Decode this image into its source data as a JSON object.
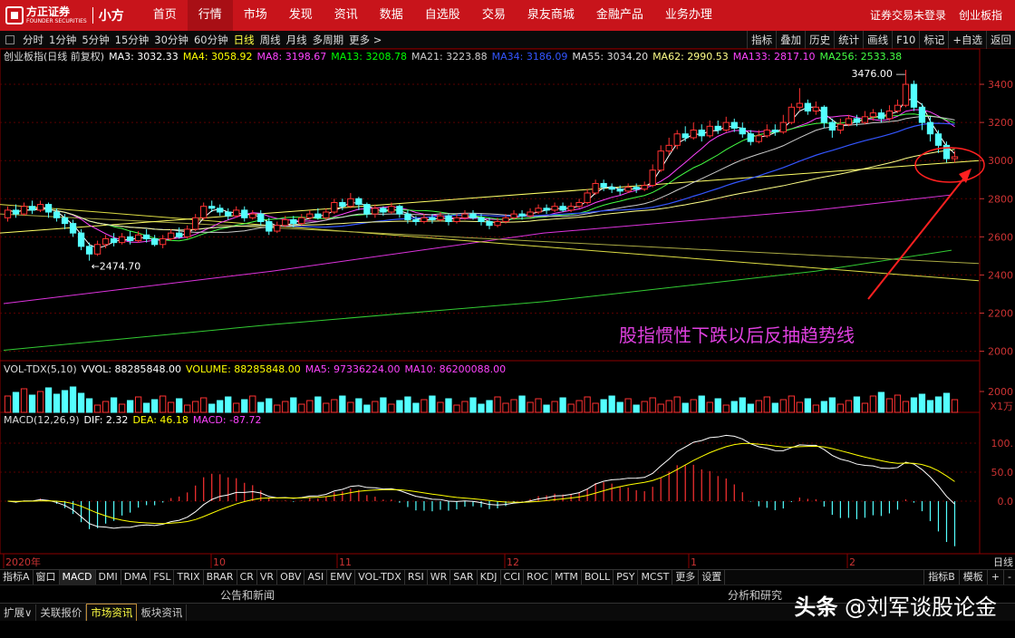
{
  "app": {
    "logo_cn": "方正证券",
    "logo_en": "FOUNDER SECURITIES",
    "logo_app": "小方"
  },
  "nav": [
    "首页",
    "行情",
    "市场",
    "发现",
    "资讯",
    "数据",
    "自选股",
    "交易",
    "泉友商城",
    "金融产品",
    "业务办理"
  ],
  "nav_active": 1,
  "nav_right": {
    "login": "证券交易未登录",
    "symbol": "创业板指"
  },
  "periods": [
    "分时",
    "1分钟",
    "5分钟",
    "15分钟",
    "30分钟",
    "60分钟",
    "日线",
    "周线",
    "月线",
    "多周期",
    "更多 >"
  ],
  "period_active": 6,
  "toolbar_right": [
    "指标",
    "叠加",
    "历史",
    "统计",
    "画线",
    "F10",
    "标记",
    "+自选",
    "返回"
  ],
  "ma_line": {
    "title": "创业板指(日线 前复权)",
    "items": [
      {
        "label": "MA3: 3032.33",
        "color": "#ffffff"
      },
      {
        "label": "MA4: 3058.92",
        "color": "#ffff00"
      },
      {
        "label": "MA8: 3198.67",
        "color": "#ff44ff"
      },
      {
        "label": "MA13: 3208.78",
        "color": "#00ff00"
      },
      {
        "label": "MA21: 3223.88",
        "color": "#cccccc"
      },
      {
        "label": "MA34: 3186.09",
        "color": "#3355ff"
      },
      {
        "label": "MA55: 3034.20",
        "color": "#dddddd"
      },
      {
        "label": "MA62: 2990.53",
        "color": "#ffff88"
      },
      {
        "label": "MA133: 2817.10",
        "color": "#ff44ff"
      },
      {
        "label": "MA256: 2533.38",
        "color": "#44ff44"
      }
    ]
  },
  "main_axis": [
    "3400",
    "3200",
    "3000",
    "2800",
    "2600",
    "2400",
    "2200",
    "2000"
  ],
  "main_annotations": {
    "high": "3476.00",
    "low": "2474.70"
  },
  "annotation_text": "股指惯性下跌以后反抽趋势线",
  "vol_line": {
    "items": [
      {
        "label": "VOL-TDX(5,10)",
        "color": "#dddddd"
      },
      {
        "label": "VVOL: 88285848.00",
        "color": "#ffffff"
      },
      {
        "label": "VOLUME: 88285848.00",
        "color": "#ffff00"
      },
      {
        "label": "MA5: 97336224.00",
        "color": "#ff44ff"
      },
      {
        "label": "MA10: 86200088.00",
        "color": "#ff44ff"
      }
    ]
  },
  "vol_axis": {
    "top": "2000",
    "unit": "X1万"
  },
  "macd_line": {
    "items": [
      {
        "label": "MACD(12,26,9)",
        "color": "#dddddd"
      },
      {
        "label": "DIF: 2.32",
        "color": "#ffffff"
      },
      {
        "label": "DEA: 46.18",
        "color": "#ffff00"
      },
      {
        "label": "MACD: -87.72",
        "color": "#ff44ff"
      }
    ]
  },
  "macd_axis": [
    "100.",
    "50.0",
    "0.0"
  ],
  "x_axis": {
    "labels": [
      {
        "text": "2020年",
        "pos": "start"
      },
      {
        "text": "10",
        "pos": "oct"
      },
      {
        "text": "11",
        "pos": "nov"
      },
      {
        "text": "12",
        "pos": "dec"
      },
      {
        "text": "1",
        "pos": "jan"
      },
      {
        "text": "2",
        "pos": "feb"
      }
    ],
    "right_label": "日线"
  },
  "indicator_tabs": [
    "指标A",
    "窗口",
    "MACD",
    "DMI",
    "DMA",
    "FSL",
    "TRIX",
    "BRAR",
    "CR",
    "VR",
    "OBV",
    "ASI",
    "EMV",
    "VOL-TDX",
    "RSI",
    "WR",
    "SAR",
    "KDJ",
    "CCI",
    "ROC",
    "MTM",
    "BOLL",
    "PSY",
    "MCST",
    "更多",
    "设置"
  ],
  "indicator_active": 2,
  "indicator_right": [
    "指标B",
    "模板",
    "+",
    "-"
  ],
  "news": {
    "left": "公告和新闻",
    "right": "分析和研究"
  },
  "bottom_tabs": [
    "扩展∨",
    "关联报价",
    "市场资讯",
    "板块资讯"
  ],
  "bottom_active": 2,
  "watermark": {
    "brand": "头条",
    "text": "@刘军谈股论金"
  },
  "colors": {
    "up": "#ff3232",
    "down": "#54ffff",
    "nav_bg": "#c8141b",
    "axis_red": "#cc3333"
  },
  "chart_data": {
    "type": "candlestick",
    "title": "创业板指(日线 前复权)",
    "y_ticks": [
      3400,
      3200,
      3000,
      2800,
      2600,
      2400,
      2200,
      2000
    ],
    "ylim": [
      1960,
      3500
    ],
    "candles": [
      [
        2700,
        2740,
        2760,
        2680
      ],
      [
        2740,
        2720,
        2770,
        2700
      ],
      [
        2720,
        2760,
        2780,
        2710
      ],
      [
        2760,
        2740,
        2790,
        2720
      ],
      [
        2740,
        2770,
        2790,
        2730
      ],
      [
        2770,
        2730,
        2780,
        2700
      ],
      [
        2730,
        2700,
        2750,
        2680
      ],
      [
        2700,
        2670,
        2720,
        2640
      ],
      [
        2670,
        2620,
        2690,
        2600
      ],
      [
        2620,
        2550,
        2640,
        2530
      ],
      [
        2550,
        2510,
        2570,
        2475
      ],
      [
        2510,
        2560,
        2580,
        2500
      ],
      [
        2560,
        2590,
        2610,
        2540
      ],
      [
        2590,
        2570,
        2620,
        2550
      ],
      [
        2570,
        2600,
        2620,
        2560
      ],
      [
        2600,
        2580,
        2630,
        2560
      ],
      [
        2580,
        2610,
        2630,
        2570
      ],
      [
        2610,
        2590,
        2640,
        2570
      ],
      [
        2590,
        2560,
        2610,
        2550
      ],
      [
        2560,
        2590,
        2610,
        2540
      ],
      [
        2590,
        2620,
        2640,
        2580
      ],
      [
        2620,
        2600,
        2650,
        2590
      ],
      [
        2600,
        2640,
        2660,
        2590
      ],
      [
        2640,
        2700,
        2720,
        2630
      ],
      [
        2700,
        2760,
        2780,
        2690
      ],
      [
        2760,
        2750,
        2790,
        2730
      ],
      [
        2750,
        2730,
        2770,
        2710
      ],
      [
        2730,
        2710,
        2750,
        2690
      ],
      [
        2710,
        2740,
        2760,
        2700
      ],
      [
        2740,
        2700,
        2760,
        2680
      ],
      [
        2700,
        2720,
        2740,
        2690
      ],
      [
        2720,
        2680,
        2740,
        2660
      ],
      [
        2680,
        2630,
        2700,
        2610
      ],
      [
        2630,
        2660,
        2680,
        2620
      ],
      [
        2660,
        2690,
        2710,
        2650
      ],
      [
        2690,
        2670,
        2710,
        2650
      ],
      [
        2670,
        2700,
        2720,
        2660
      ],
      [
        2700,
        2720,
        2740,
        2690
      ],
      [
        2720,
        2700,
        2750,
        2690
      ],
      [
        2700,
        2730,
        2750,
        2690
      ],
      [
        2730,
        2780,
        2800,
        2720
      ],
      [
        2780,
        2760,
        2800,
        2740
      ],
      [
        2760,
        2800,
        2830,
        2750
      ],
      [
        2800,
        2770,
        2810,
        2740
      ],
      [
        2770,
        2720,
        2780,
        2700
      ],
      [
        2720,
        2750,
        2770,
        2700
      ],
      [
        2750,
        2730,
        2760,
        2710
      ],
      [
        2730,
        2760,
        2780,
        2720
      ],
      [
        2760,
        2720,
        2770,
        2700
      ],
      [
        2720,
        2690,
        2740,
        2670
      ],
      [
        2690,
        2680,
        2710,
        2660
      ],
      [
        2680,
        2700,
        2720,
        2670
      ],
      [
        2700,
        2690,
        2720,
        2670
      ],
      [
        2690,
        2710,
        2730,
        2680
      ],
      [
        2710,
        2680,
        2720,
        2660
      ],
      [
        2680,
        2700,
        2720,
        2670
      ],
      [
        2700,
        2720,
        2740,
        2690
      ],
      [
        2720,
        2700,
        2740,
        2690
      ],
      [
        2700,
        2680,
        2720,
        2660
      ],
      [
        2680,
        2660,
        2700,
        2640
      ],
      [
        2660,
        2680,
        2700,
        2650
      ],
      [
        2680,
        2700,
        2720,
        2670
      ],
      [
        2700,
        2720,
        2740,
        2690
      ],
      [
        2720,
        2710,
        2740,
        2690
      ],
      [
        2710,
        2730,
        2750,
        2700
      ],
      [
        2730,
        2750,
        2770,
        2720
      ],
      [
        2750,
        2740,
        2770,
        2720
      ],
      [
        2740,
        2760,
        2780,
        2730
      ],
      [
        2760,
        2740,
        2780,
        2730
      ],
      [
        2740,
        2760,
        2780,
        2730
      ],
      [
        2760,
        2780,
        2800,
        2750
      ],
      [
        2780,
        2830,
        2850,
        2770
      ],
      [
        2830,
        2880,
        2900,
        2820
      ],
      [
        2880,
        2860,
        2900,
        2840
      ],
      [
        2860,
        2850,
        2880,
        2830
      ],
      [
        2850,
        2840,
        2870,
        2820
      ],
      [
        2840,
        2860,
        2880,
        2830
      ],
      [
        2860,
        2850,
        2880,
        2830
      ],
      [
        2850,
        2870,
        2890,
        2840
      ],
      [
        2870,
        2950,
        2980,
        2860
      ],
      [
        2950,
        3050,
        3080,
        2940
      ],
      [
        3050,
        3080,
        3120,
        3030
      ],
      [
        3080,
        3140,
        3160,
        3060
      ],
      [
        3140,
        3120,
        3180,
        3100
      ],
      [
        3120,
        3160,
        3200,
        3110
      ],
      [
        3160,
        3130,
        3190,
        3100
      ],
      [
        3130,
        3180,
        3210,
        3120
      ],
      [
        3180,
        3160,
        3210,
        3140
      ],
      [
        3160,
        3200,
        3230,
        3150
      ],
      [
        3200,
        3170,
        3220,
        3150
      ],
      [
        3170,
        3140,
        3200,
        3120
      ],
      [
        3140,
        3100,
        3160,
        3080
      ],
      [
        3100,
        3130,
        3160,
        3090
      ],
      [
        3130,
        3160,
        3190,
        3120
      ],
      [
        3160,
        3150,
        3190,
        3130
      ],
      [
        3150,
        3200,
        3240,
        3140
      ],
      [
        3200,
        3280,
        3300,
        3190
      ],
      [
        3280,
        3300,
        3380,
        3260
      ],
      [
        3300,
        3260,
        3320,
        3240
      ],
      [
        3260,
        3280,
        3310,
        3240
      ],
      [
        3280,
        3200,
        3290,
        3170
      ],
      [
        3200,
        3160,
        3220,
        3120
      ],
      [
        3160,
        3190,
        3220,
        3140
      ],
      [
        3190,
        3220,
        3240,
        3180
      ],
      [
        3220,
        3200,
        3240,
        3180
      ],
      [
        3200,
        3230,
        3260,
        3190
      ],
      [
        3230,
        3250,
        3270,
        3210
      ],
      [
        3250,
        3220,
        3270,
        3200
      ],
      [
        3220,
        3260,
        3290,
        3210
      ],
      [
        3260,
        3290,
        3320,
        3250
      ],
      [
        3290,
        3400,
        3476,
        3280
      ],
      [
        3400,
        3280,
        3420,
        3260
      ],
      [
        3280,
        3200,
        3300,
        3160
      ],
      [
        3200,
        3140,
        3230,
        3100
      ],
      [
        3140,
        3080,
        3160,
        3040
      ],
      [
        3080,
        3010,
        3100,
        2990
      ],
      [
        3010,
        3020,
        3050,
        2990
      ]
    ],
    "volume_bar_top": 2000,
    "macd": {
      "dif": 2.32,
      "dea": 46.18,
      "macd": -87.72,
      "y_ticks": [
        100,
        50,
        0
      ]
    }
  }
}
